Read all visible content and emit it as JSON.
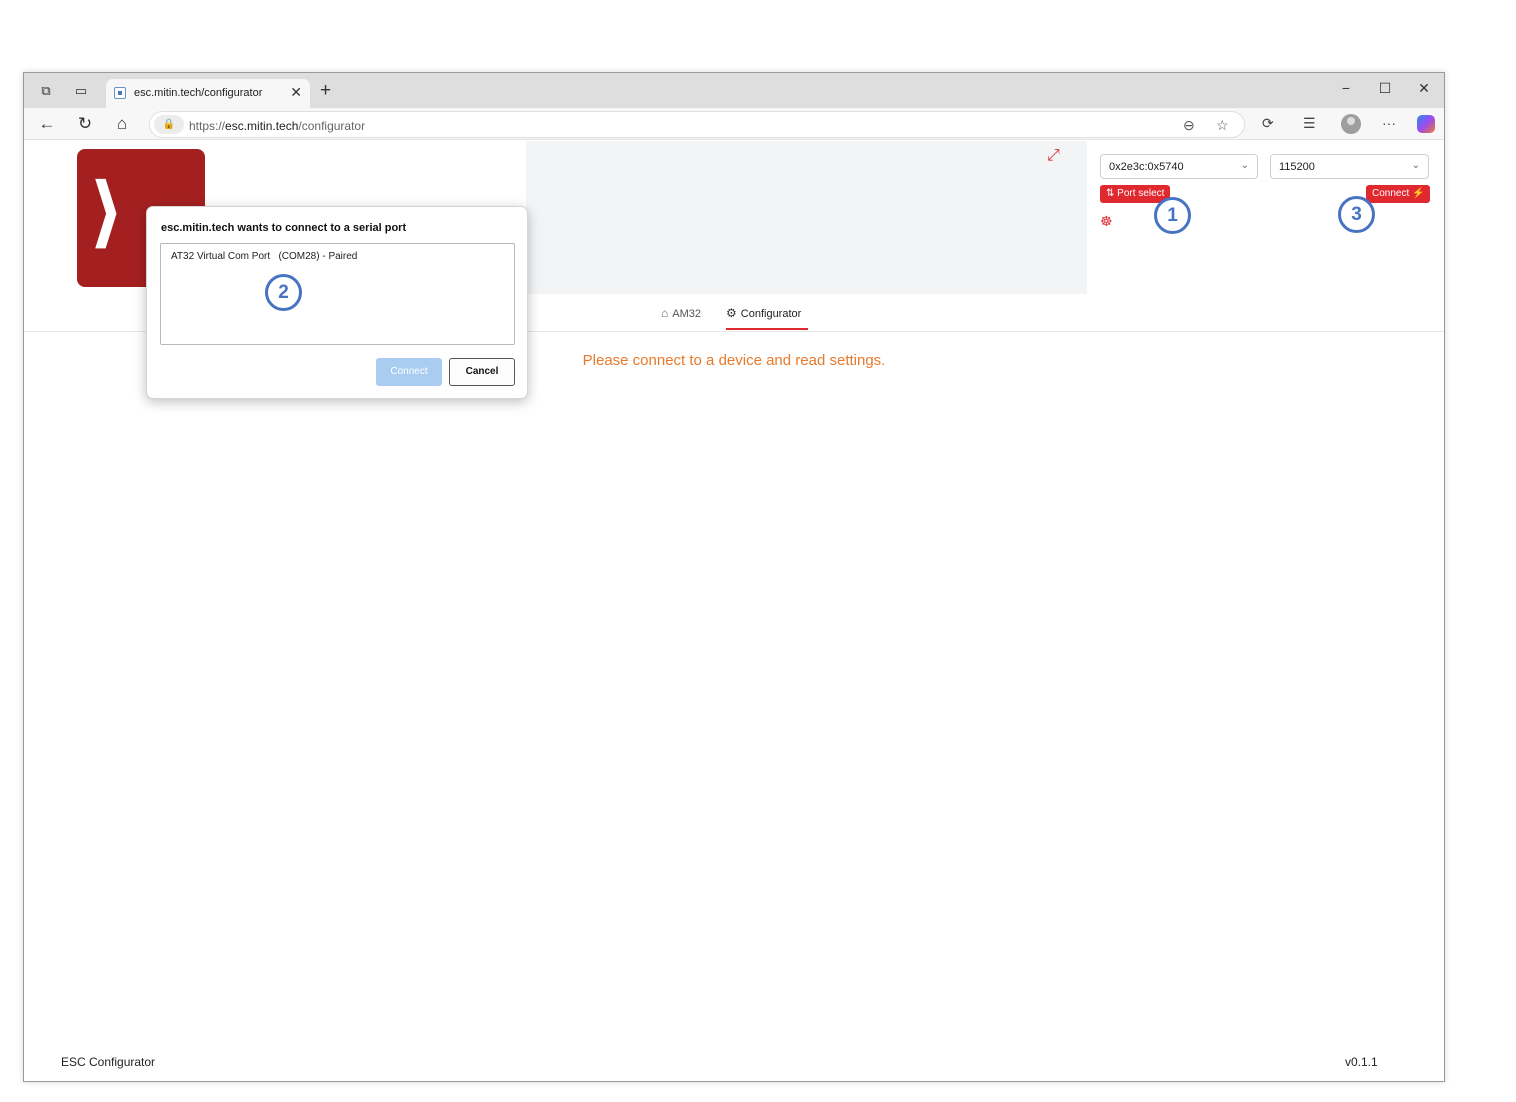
{
  "browser": {
    "tab_title": "esc.mitin.tech/configurator",
    "url_scheme": "https://",
    "url_host": "esc.mitin.tech",
    "url_path": "/configurator"
  },
  "header": {
    "port_value": "0x2e3c:0x5740",
    "baud_value": "115200",
    "port_select_label": "Port select",
    "connect_label": "Connect"
  },
  "nav": {
    "tabs": [
      {
        "label": "AM32",
        "icon": "home-icon"
      },
      {
        "label": "Configurator",
        "icon": "chip-icon",
        "active": true
      }
    ]
  },
  "main": {
    "message": "Please connect to a device and read settings."
  },
  "dialog": {
    "title": "esc.mitin.tech wants to connect to a serial port",
    "items": [
      "AT32 Virtual Com Port   (COM28) - Paired"
    ],
    "connect_label": "Connect",
    "cancel_label": "Cancel"
  },
  "annotations": [
    "1",
    "2",
    "3"
  ],
  "footer": {
    "app_name": "ESC Configurator",
    "version": "v0.1.1"
  },
  "colors": {
    "accent_red": "#e0282f",
    "message_orange": "#e77a2c",
    "annotation_blue": "#4674c3",
    "logo_red": "#a42020"
  }
}
